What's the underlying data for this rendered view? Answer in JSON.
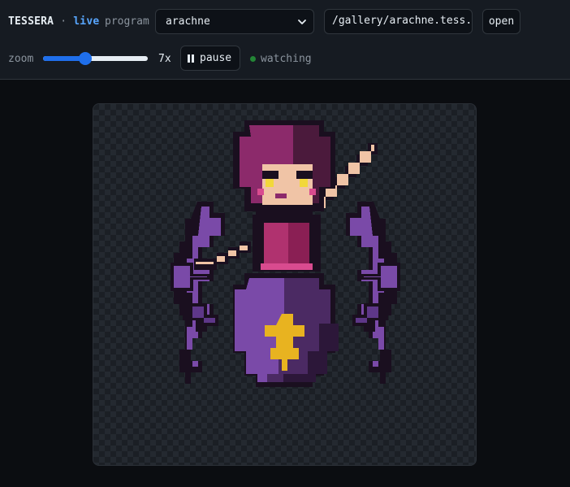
{
  "header": {
    "brand": "TESSERA",
    "separator": "·",
    "status": "live",
    "program_label": "program"
  },
  "program_select": {
    "value": "arachne"
  },
  "path_input": {
    "value": "/gallery/arachne.tess.j"
  },
  "open_button": {
    "label": "open"
  },
  "zoom": {
    "label": "zoom",
    "value": "7x",
    "fraction": 0.4
  },
  "pause_button": {
    "label": "pause"
  },
  "watch_status": {
    "label": "watching",
    "color": "#238636"
  },
  "icons": [
    "chevron-down-icon",
    "pause-icon",
    "status-dot"
  ],
  "colors": {
    "accent": "#1f6feb",
    "live": "#58a6ff",
    "hair": "#8c2a6b",
    "skin": "#f0c4a6",
    "dress": "#7a4aa8",
    "gem": "#e8b320",
    "outline": "#1a0f1f"
  }
}
